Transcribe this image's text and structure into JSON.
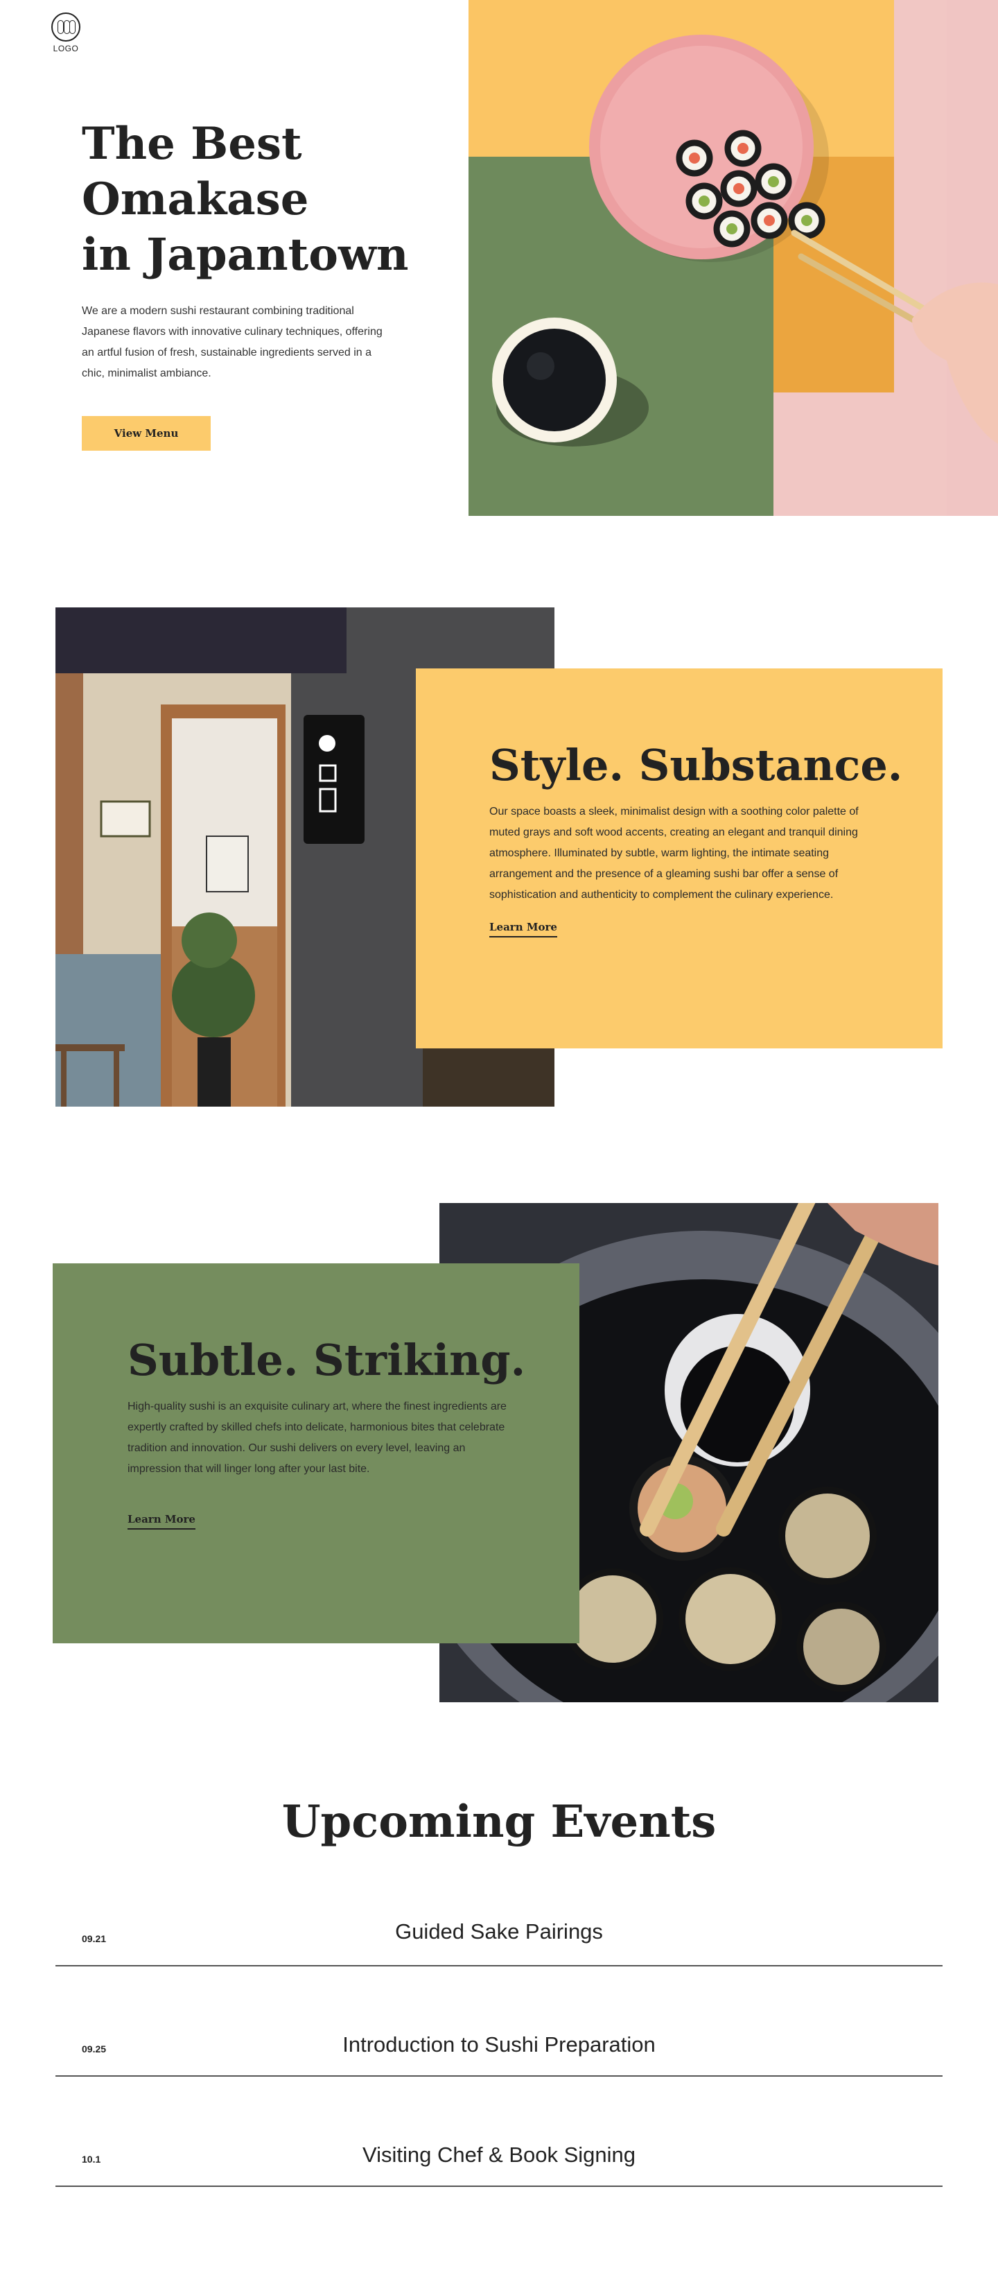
{
  "header": {
    "logo_text": "LOGO",
    "menu_icon": "hamburger-icon"
  },
  "hero": {
    "title_lines": [
      "The Best",
      "Omakase",
      "in Japantown"
    ],
    "description": "We are a modern sushi restaurant combining traditional Japanese flavors with innovative culinary techniques, offering an artful fusion of fresh, sustainable ingredients served in a chic, minimalist ambiance.",
    "button_label": "View Menu",
    "button_color": "#fccb6c"
  },
  "style_section": {
    "title": "Style. Substance.",
    "text": "Our space boasts a sleek, minimalist design with a soothing color palette of muted grays and soft wood accents, creating an elegant and tranquil dining atmosphere. Illuminated by subtle, warm lighting, the intimate seating arrangement and the presence of a gleaming sushi bar offer a sense of sophistication and authenticity to complement the culinary experience.",
    "link_label": "Learn More",
    "panel_color": "#fccb6c"
  },
  "subtle_section": {
    "title": "Subtle. Striking.",
    "text": "High-quality sushi is an exquisite culinary art, where the finest ingredients are expertly crafted by skilled chefs into delicate, harmonious bites that celebrate tradition and innovation. Our sushi delivers on every level, leaving an impression that will linger long after your last bite.",
    "link_label": "Learn More",
    "panel_color": "#758d5e"
  },
  "events": {
    "title": "Upcoming Events",
    "items": [
      {
        "date": "09.21",
        "name": "Guided Sake Pairings"
      },
      {
        "date": "09.25",
        "name": "Introduction to Sushi Preparation"
      },
      {
        "date": "10.1",
        "name": "Visiting Chef & Book Signing"
      }
    ]
  }
}
